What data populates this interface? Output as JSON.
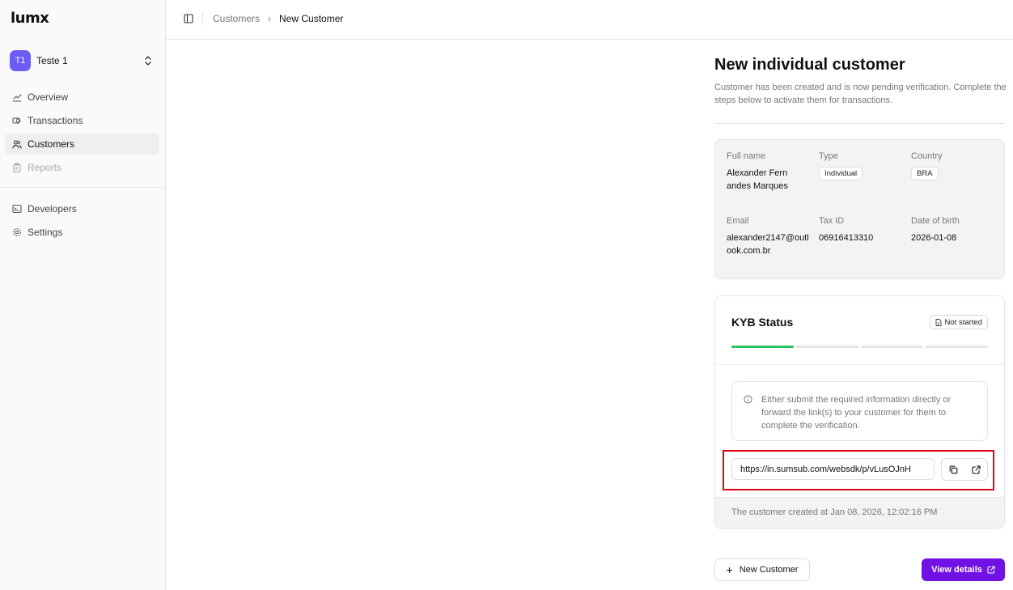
{
  "brand": {
    "logo": "LUMX",
    "accent": "#7012e4",
    "success": "#22c55e",
    "highlight": "#e0000f"
  },
  "org": {
    "initials": "T1",
    "name": "Teste 1"
  },
  "sidebar": {
    "items": [
      {
        "label": "Overview",
        "icon": "chart-icon"
      },
      {
        "label": "Transactions",
        "icon": "transactions-icon"
      },
      {
        "label": "Customers",
        "icon": "users-icon",
        "active": true
      },
      {
        "label": "Reports",
        "icon": "clipboard-icon",
        "disabled": true
      }
    ],
    "secondary": [
      {
        "label": "Developers",
        "icon": "terminal-icon"
      },
      {
        "label": "Settings",
        "icon": "gear-icon"
      }
    ]
  },
  "breadcrumb": {
    "parent": "Customers",
    "current": "New Customer"
  },
  "page": {
    "title": "New individual customer",
    "subtitle": "Customer has been created and is now pending verification. Complete the steps below to activate them for transactions."
  },
  "customer": {
    "full_name_label": "Full name",
    "full_name": "Alexander Fernandes Marques",
    "type_label": "Type",
    "type": "Individual",
    "country_label": "Country",
    "country": "BRA",
    "email_label": "Email",
    "email": "alexander2147@outlook.com.br",
    "tax_id_label": "Tax ID",
    "tax_id": "06916413310",
    "dob_label": "Date of birth",
    "dob": "2026-01-08"
  },
  "kyb": {
    "title": "KYB Status",
    "status": "Not started",
    "progress_steps": 4,
    "progress_done": 1,
    "notice": "Either submit the required information directly or forward the link(s) to your customer for them to complete the verification.",
    "link": "https://in.sumsub.com/websdk/p/vLusOJnH",
    "footer": "The customer created at Jan 08, 2026, 12:02:16 PM"
  },
  "actions": {
    "new_customer": "New Customer",
    "view_details": "View details"
  }
}
